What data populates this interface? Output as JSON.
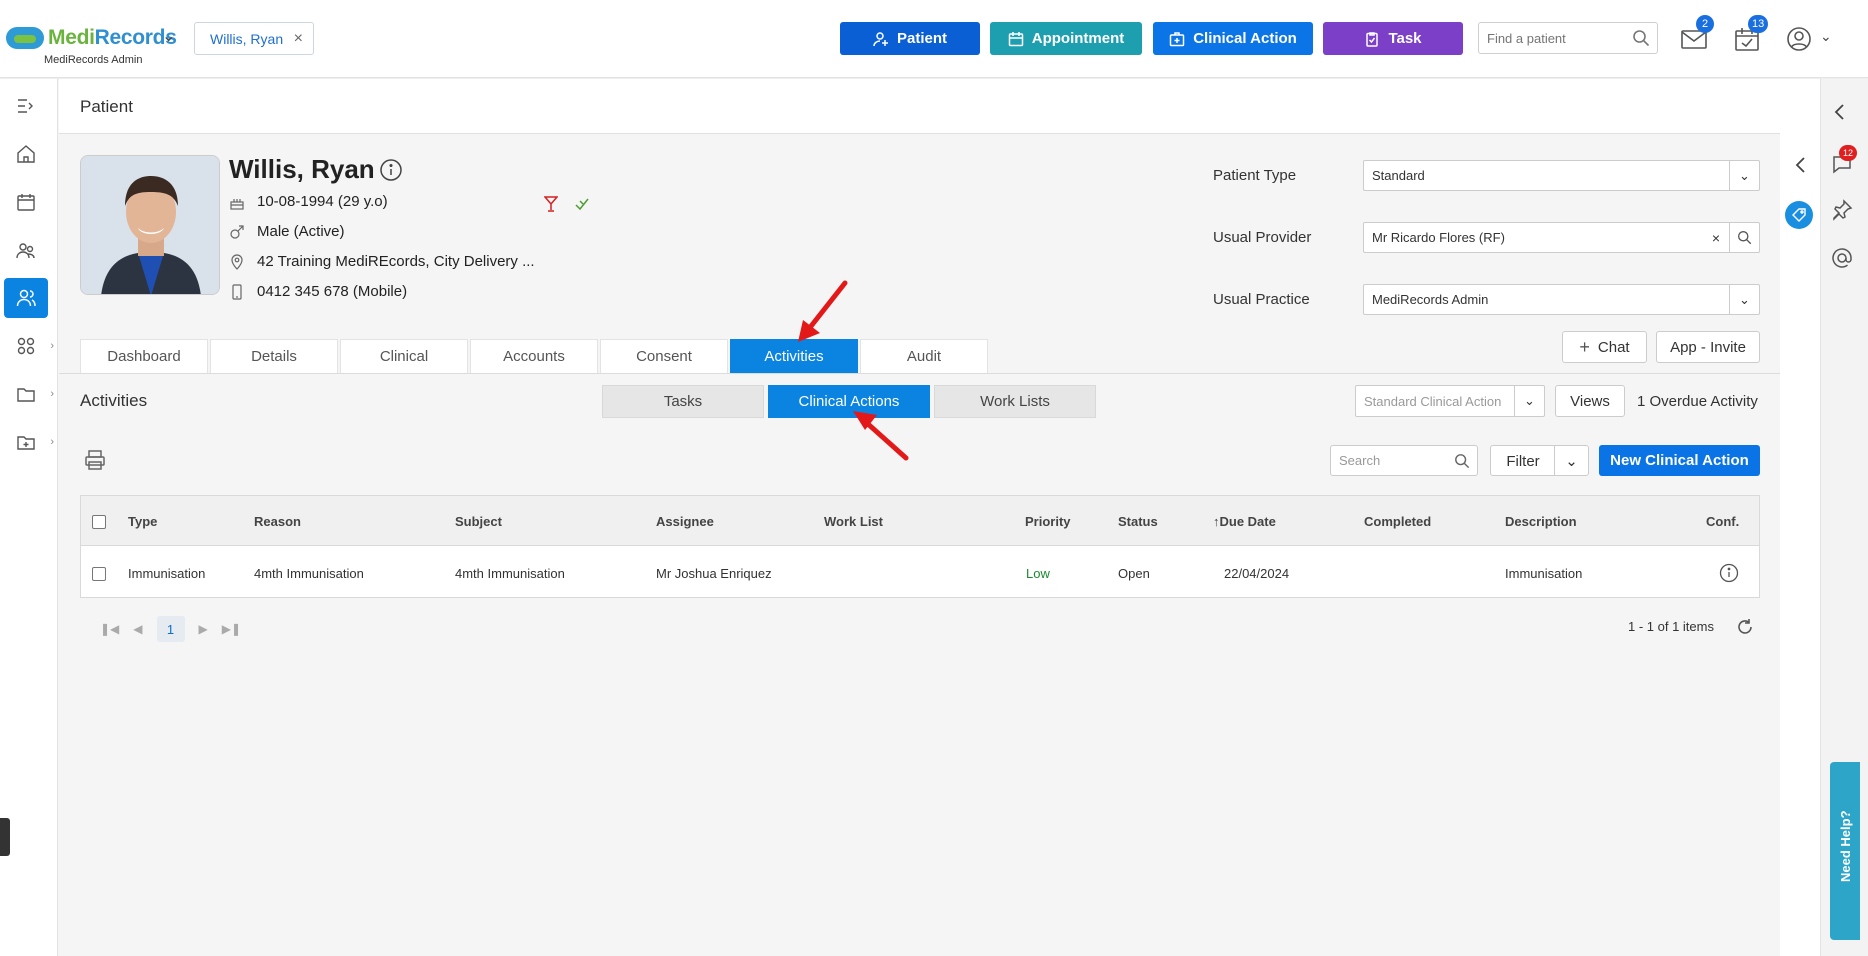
{
  "header": {
    "brand_main": "Medi",
    "brand_accent": "Records",
    "brand_sub": "MediRecords Admin",
    "patient_chip": "Willis, Ryan",
    "buttons": {
      "patient": "Patient",
      "appointment": "Appointment",
      "clinical_action": "Clinical Action",
      "task": "Task"
    },
    "search_placeholder": "Find a patient",
    "mail_badge": "2",
    "tasks_badge": "13",
    "colors": {
      "patient": "#0a5fd4",
      "appointment": "#1d9fb0",
      "clinical_action": "#0b74e6",
      "task": "#7b3fc8"
    }
  },
  "page": {
    "title": "Patient"
  },
  "patient": {
    "name": "Willis, Ryan",
    "dob": "10-08-1994 (29 y.o)",
    "gender": "Male (Active)",
    "address": "42 Training MediREcords, City Delivery ...",
    "phone": "0412 345 678 (Mobile)",
    "fields": {
      "patient_type_label": "Patient Type",
      "patient_type_value": "Standard",
      "usual_provider_label": "Usual Provider",
      "usual_provider_value": "Mr Ricardo Flores (RF)",
      "usual_practice_label": "Usual Practice",
      "usual_practice_value": "MediRecords Admin"
    },
    "chat_label": "Chat",
    "app_invite_label": "App - Invite"
  },
  "tabs": [
    "Dashboard",
    "Details",
    "Clinical",
    "Accounts",
    "Consent",
    "Activities",
    "Audit"
  ],
  "activities": {
    "title": "Activities",
    "segments": [
      "Tasks",
      "Clinical Actions",
      "Work Lists"
    ],
    "view_select_placeholder": "Standard Clinical Action",
    "views_label": "Views",
    "overdue": "1 Overdue Activity",
    "search_placeholder": "Search",
    "filter_label": "Filter",
    "new_button": "New Clinical Action"
  },
  "table": {
    "columns": [
      "Type",
      "Reason",
      "Subject",
      "Assignee",
      "Work List",
      "Priority",
      "Status",
      "Due Date",
      "Completed",
      "Description",
      "Conf."
    ],
    "rows": [
      {
        "type": "Immunisation",
        "reason": "4mth Immunisation",
        "subject": "4mth Immunisation",
        "assignee": "Mr Joshua Enriquez",
        "work_list": "",
        "priority": "Low",
        "status": "Open",
        "due_date": "22/04/2024",
        "completed": "",
        "description": "Immunisation"
      }
    ]
  },
  "pager": {
    "page": "1",
    "summary": "1 - 1 of 1 items"
  },
  "right_rail": {
    "notification_badge": "12",
    "need_help": "Need Help?"
  }
}
